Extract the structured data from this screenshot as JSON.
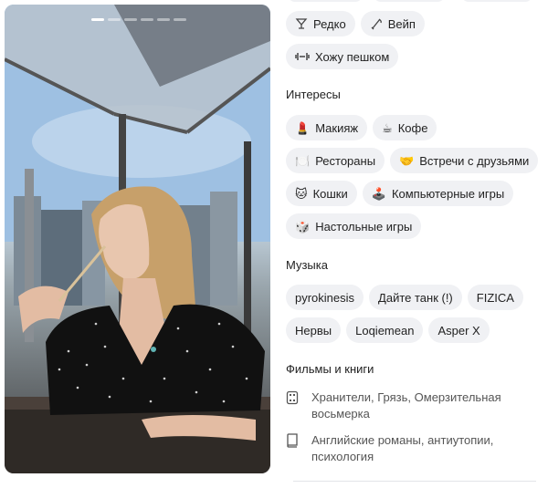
{
  "photo": {
    "carousel_count": 6,
    "carousel_active": 0
  },
  "lifestyle": {
    "chips": [
      {
        "icon": "cocktail-glass-icon",
        "label": "Редко"
      },
      {
        "icon": "vape-pen-icon",
        "label": "Вейп"
      },
      {
        "icon": "dumbbell-icon",
        "label": "Хожу пешком"
      }
    ]
  },
  "interests": {
    "title": "Интересы",
    "chips": [
      {
        "icon": "lipstick-icon",
        "glyph": "💄",
        "label": "Макияж"
      },
      {
        "icon": "coffee-icon",
        "glyph": "☕",
        "label": "Кофе"
      },
      {
        "icon": "fork-knife-plate-icon",
        "glyph": "🍽️",
        "label": "Рестораны"
      },
      {
        "icon": "handshake-icon",
        "glyph": "🤝",
        "label": "Встречи с друзьями"
      },
      {
        "icon": "cat-icon",
        "glyph": "🐱",
        "label": "Кошки"
      },
      {
        "icon": "joystick-icon",
        "glyph": "🕹️",
        "label": "Компьютерные игры"
      },
      {
        "icon": "game-die-icon",
        "glyph": "🎲",
        "label": "Настольные игры"
      }
    ]
  },
  "music": {
    "title": "Музыка",
    "chips": [
      "pyrokinesis",
      "Дайте танк (!)",
      "FIZICA",
      "Нервы",
      "Loqiemean",
      "Asper X"
    ]
  },
  "films_books": {
    "title": "Фильмы и книги",
    "items": [
      {
        "icon": "film-icon",
        "text": "Хранители, Грязь, Омерзительная восьмерка"
      },
      {
        "icon": "book-icon",
        "text": "Английские романы, антиутопии, психология"
      }
    ]
  },
  "colors": {
    "chip_bg": "#f0f1f4",
    "text": "#222222",
    "muted": "#555555"
  }
}
